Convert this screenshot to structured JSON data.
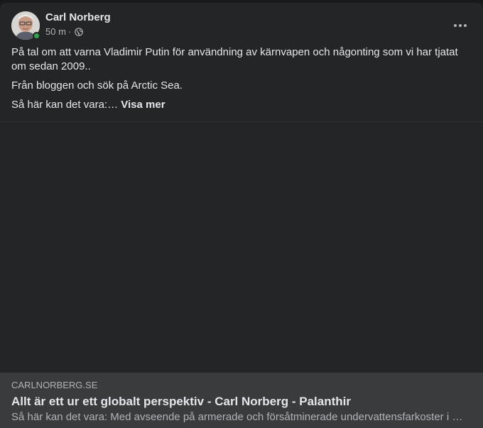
{
  "post": {
    "author": "Carl Norberg",
    "time": "50 m",
    "separator": "·",
    "privacy_icon": "globe-icon",
    "online": true,
    "paragraphs": [
      "På tal om att varna Vladimir Putin för användning av kärnvapen och någonting som vi har tjatat om sedan 2009..",
      "Från bloggen och sök på Arctic Sea."
    ],
    "truncated_text": "Så här kan det vara:…",
    "see_more_label": "Visa mer",
    "more_icon": "more-horizontal-icon"
  },
  "link_preview": {
    "domain": "CARLNORBERG.SE",
    "title": "Allt är ett ur ett globalt perspektiv - Carl Norberg - Palanthir",
    "description": "Så här kan det vara: Med avseende på armerade och försåtminerade undervattensfarkoster i …"
  },
  "colors": {
    "background": "#242526",
    "page": "#18191a",
    "preview": "#3a3b3c",
    "text_primary": "#e4e6eb",
    "text_secondary": "#b0b3b8",
    "online": "#31a24c"
  }
}
